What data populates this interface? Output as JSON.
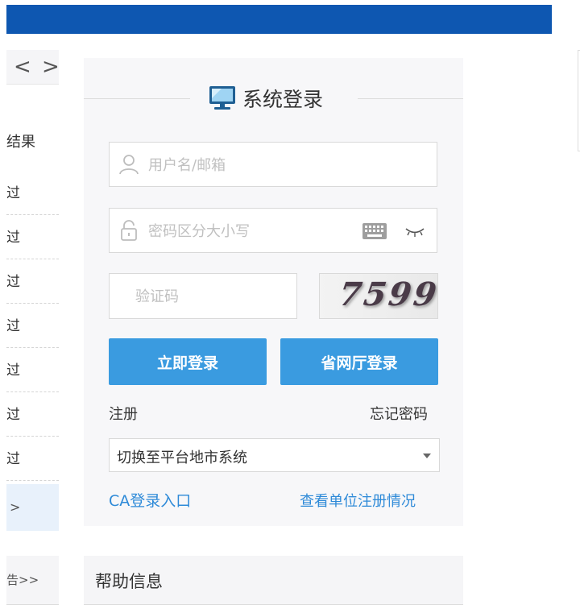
{
  "left": {
    "prev_glyph": "<",
    "next_glyph": ">",
    "result_header": "结果",
    "results": [
      "过",
      "过",
      "过",
      "过",
      "过",
      "过",
      "过"
    ],
    "more_glyph": ">",
    "notice_link": "告>>"
  },
  "login": {
    "title": "系统登录",
    "username_placeholder": "用户名/邮箱",
    "password_placeholder": "密码区分大小写",
    "captcha_placeholder": "验证码",
    "captcha_text": "7599",
    "login_button": "立即登录",
    "province_button": "省网厅登录",
    "register": "注册",
    "forgot": "忘记密码",
    "switch_select": "切换至平台地市系统",
    "ca_link": "CA登录入口",
    "view_registration": "查看单位注册情况"
  },
  "help": {
    "title": "帮助信息"
  },
  "colors": {
    "topbar": "#0e57b1",
    "button": "#3a9be0",
    "link": "#2e8ad8",
    "panel": "#f7f7f9"
  },
  "icons": [
    "monitor-icon",
    "user-icon",
    "lock-icon",
    "keyboard-icon",
    "eye-closed-icon",
    "chevron-down-icon"
  ]
}
